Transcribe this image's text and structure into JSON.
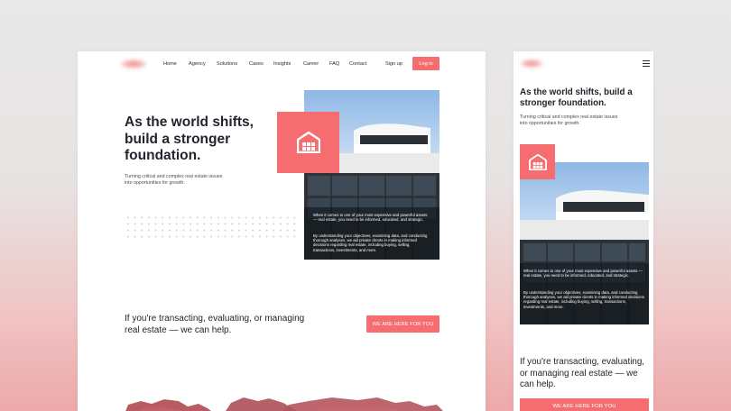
{
  "desktop": {
    "nav": {
      "items": [
        "Home",
        "Agency",
        "Solutions",
        "Cases",
        "Insights",
        "Career",
        "FAQ",
        "Contact"
      ],
      "signup_label": "Sign up",
      "login_label": "Log in"
    },
    "hero": {
      "title": "As the world shifts, build a stronger foundation.",
      "subtitle": "Turning critical and complex real estate issues into opportunities for growth."
    },
    "image_overlay": {
      "paragraph1": "When it comes to one of your most expensive and powerful assets — real estate, you need to be informed, educated, and strategic.",
      "paragraph2": "By understanding your objectives, examining data, and conducting thorough analyses, we aid private clients in making informed decisions regarding real estate, including buying, selling, transactions, investments, and more."
    },
    "cta": {
      "text": "If you're transacting, evaluating, or managing real estate — we can help.",
      "button_label": "WE ARE HERE FOR YOU"
    }
  },
  "mobile": {
    "hero": {
      "title": "As the world shifts, build a stronger foundation.",
      "subtitle": "Turning critical and complex real estate issues into opportunities for growth."
    },
    "image_overlay": {
      "paragraph1": "When it comes to one of your most expensive and powerful assets — real estate, you need to be informed, educated, and strategic.",
      "paragraph2": "By understanding your objectives, examining data, and conducting thorough analyses, we aid private clients in making informed decisions regarding real estate, including buying, selling, transactions, investments, and more."
    },
    "cta": {
      "text": "If you're transacting, evaluating, or managing real estate — we can help.",
      "button_label": "WE ARE HERE FOR YOU"
    }
  },
  "icons": {
    "home": "home-icon",
    "menu": "hamburger-menu-icon"
  },
  "colors": {
    "accent": "#f56d70",
    "text_dark": "#24242e",
    "background_top": "#e9e9e9",
    "background_bottom": "#eea8aa"
  }
}
